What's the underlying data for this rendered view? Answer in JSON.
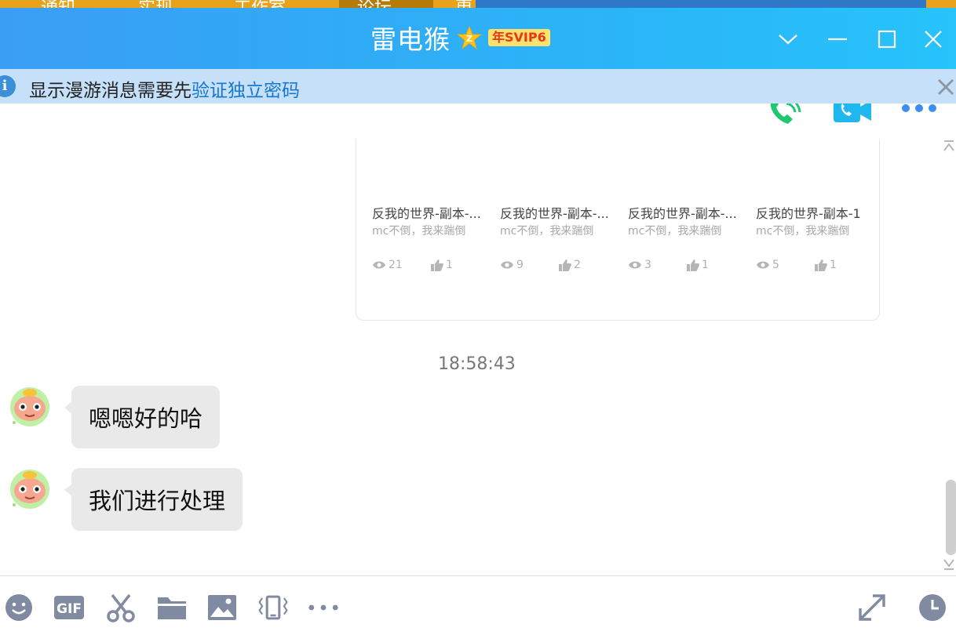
{
  "window": {
    "title": "雷电猴",
    "vip_badge": "年SVIP6",
    "icons": [
      "chevron-down-icon",
      "minimize-icon",
      "maximize-icon",
      "close-icon"
    ]
  },
  "background": {
    "segments": [
      "通知",
      "实现",
      "工作室",
      "论坛",
      "更"
    ]
  },
  "info_bar": {
    "text": "显示漫游消息需要先",
    "link": "验证独立密码"
  },
  "card": {
    "items": [
      {
        "title": "反我的世界-副本-...",
        "author": "mc不倒，我来踹倒",
        "views": "21",
        "likes": "1"
      },
      {
        "title": "反我的世界-副本-...",
        "author": "mc不倒，我来踹倒",
        "views": "9",
        "likes": "2"
      },
      {
        "title": "反我的世界-副本-...",
        "author": "mc不倒，我来踹倒",
        "views": "3",
        "likes": "1"
      },
      {
        "title": "反我的世界-副本-1",
        "author": "mc不倒，我来踹倒",
        "views": "5",
        "likes": "1"
      }
    ]
  },
  "chat": {
    "timestamp": "18:58:43",
    "messages": [
      {
        "text": "嗯嗯好的哈"
      },
      {
        "text": "我们进行处理"
      }
    ]
  },
  "toolbar": {
    "gif_label": "GIF",
    "tools": [
      "emoji-icon",
      "gif-icon",
      "scissors-icon",
      "folder-icon",
      "image-icon",
      "shake-icon",
      "more-icon"
    ],
    "right_tools": [
      "expand-icon",
      "history-clock-icon"
    ]
  },
  "colors": {
    "titlebar_start": "#3a9ef5",
    "titlebar_end": "#27c3fb",
    "info_bg": "#c5e0f8",
    "link": "#1577d0",
    "bubble": "#e9e9e9",
    "vip_bg": "#ffe16b",
    "vip_text": "#e5391b"
  }
}
